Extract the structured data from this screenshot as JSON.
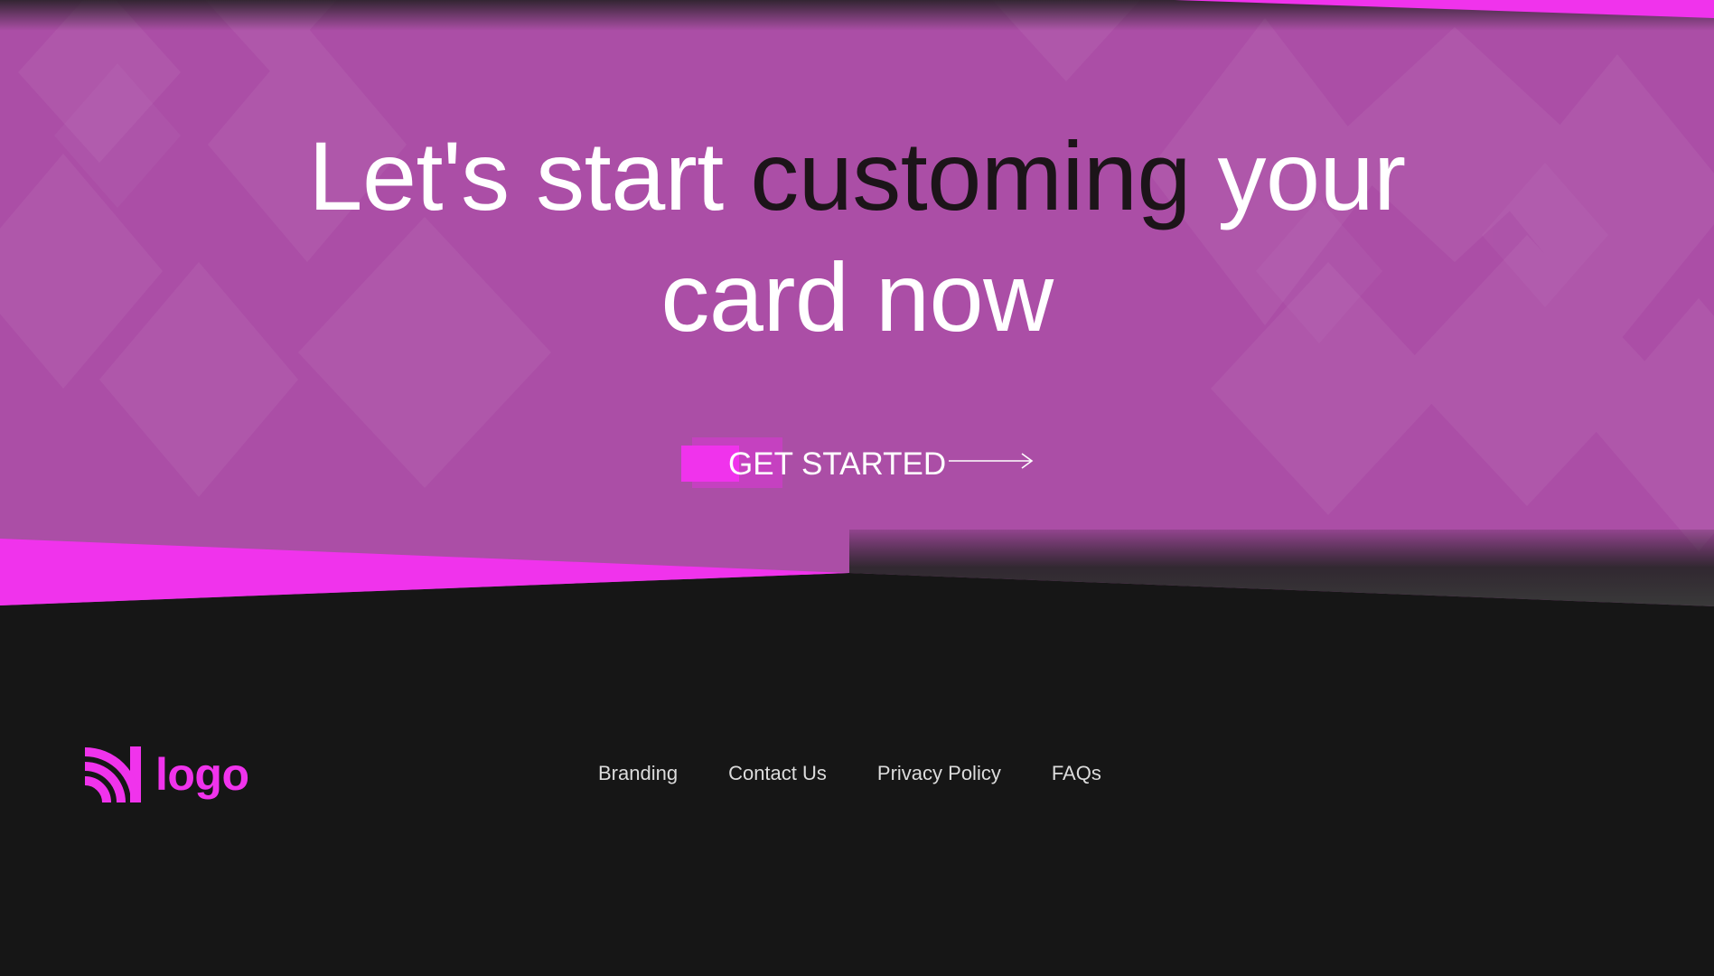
{
  "hero": {
    "headline_part1": "Let's start ",
    "headline_emphasis": "customing",
    "headline_part2": " your card now",
    "cta_label": "GET STARTED",
    "cta_icon": "arrow-right-icon"
  },
  "footer": {
    "logo_text": "logo",
    "logo_icon": "logo-arcs-icon",
    "nav": [
      {
        "label": "Branding"
      },
      {
        "label": "Contact Us"
      },
      {
        "label": "Privacy Policy"
      },
      {
        "label": "FAQs"
      }
    ]
  },
  "colors": {
    "hero_bg": "#ab4ea6",
    "accent": "#f033ec",
    "dark_bg": "#161616",
    "headline_dark": "#1c1419",
    "footer_link": "#dcdcdc"
  }
}
